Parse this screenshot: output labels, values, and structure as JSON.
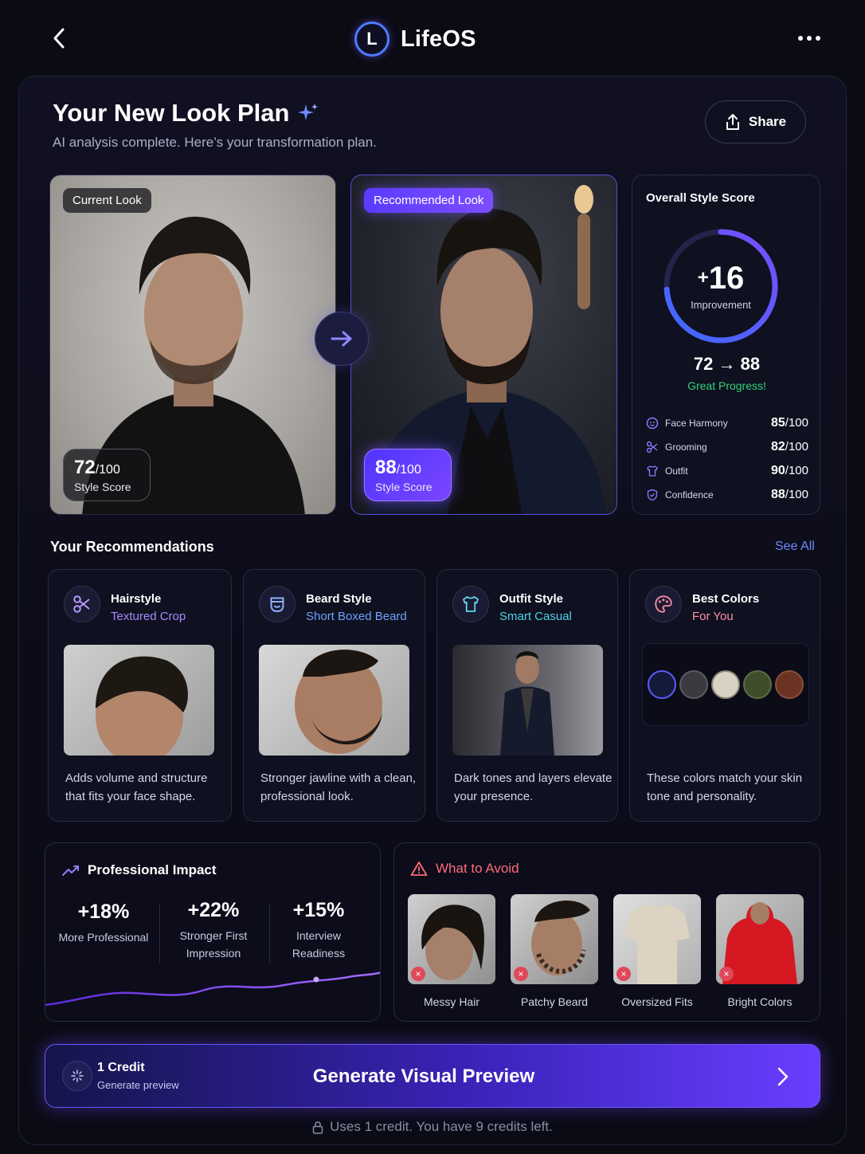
{
  "app": {
    "name": "LifeOS",
    "logo_letter": "L"
  },
  "header": {
    "title": "Your New Look Plan",
    "subtitle": "AI analysis complete. Here’s your transformation plan.",
    "share_label": "Share"
  },
  "current_look": {
    "tag": "Current Look",
    "score": "72",
    "score_max": "/100",
    "score_label": "Style Score"
  },
  "recommended_look": {
    "tag": "Recommended Look",
    "score": "88",
    "score_max": "/100",
    "score_label": "Style Score"
  },
  "style_score": {
    "title": "Overall Style Score",
    "sign": "+",
    "improvement": "16",
    "improvement_label": "Improvement",
    "range": "72 → 88",
    "progress_text": "Great Progress!",
    "ring_fraction": 0.74,
    "metrics": [
      {
        "label": "Face Harmony",
        "value": "85",
        "max": "/100",
        "icon": "face-icon"
      },
      {
        "label": "Grooming",
        "value": "82",
        "max": "/100",
        "icon": "scissors-icon"
      },
      {
        "label": "Outfit",
        "value": "90",
        "max": "/100",
        "icon": "shirt-icon"
      },
      {
        "label": "Confidence",
        "value": "88",
        "max": "/100",
        "icon": "shield-icon"
      }
    ]
  },
  "recommendations": {
    "title": "Your Recommendations",
    "see_all": "See All",
    "items": [
      {
        "title": "Hairstyle",
        "subtitle": "Textured Crop",
        "subtitle_color": "#a78bff",
        "icon": "scissors-icon",
        "description": "Adds volume and structure that fits your face shape."
      },
      {
        "title": "Beard Style",
        "subtitle": "Short Boxed Beard",
        "subtitle_color": "#6ea2ff",
        "icon": "beard-icon",
        "description": "Stronger jawline with a clean, professional look."
      },
      {
        "title": "Outfit Style",
        "subtitle": "Smart Casual",
        "subtitle_color": "#4fd1e8",
        "icon": "shirt-icon",
        "description": "Dark tones and layers elevate your presence."
      },
      {
        "title": "Best Colors",
        "subtitle": "For You",
        "subtitle_color": "#ff8fa8",
        "icon": "palette-icon",
        "description": "These colors match your skin tone and personality.",
        "swatches": [
          "#141a3a",
          "#3a3b40",
          "#d9d2c2",
          "#3e4d2a",
          "#6b3321"
        ]
      }
    ]
  },
  "impact": {
    "title": "Professional Impact",
    "stats": [
      {
        "value": "+18%",
        "label": "More Professional"
      },
      {
        "value": "+22%",
        "label": "Stronger First Impression"
      },
      {
        "value": "+15%",
        "label": "Interview Readiness"
      }
    ]
  },
  "avoid": {
    "title": "What to Avoid",
    "items": [
      {
        "label": "Messy Hair"
      },
      {
        "label": "Patchy Beard"
      },
      {
        "label": "Oversized Fits"
      },
      {
        "label": "Bright Colors"
      }
    ]
  },
  "generate": {
    "credit": "1 Credit",
    "credit_sub": "Generate preview",
    "label": "Generate Visual Preview"
  },
  "footer": {
    "note": "Uses 1 credit. You have 9 credits left."
  }
}
